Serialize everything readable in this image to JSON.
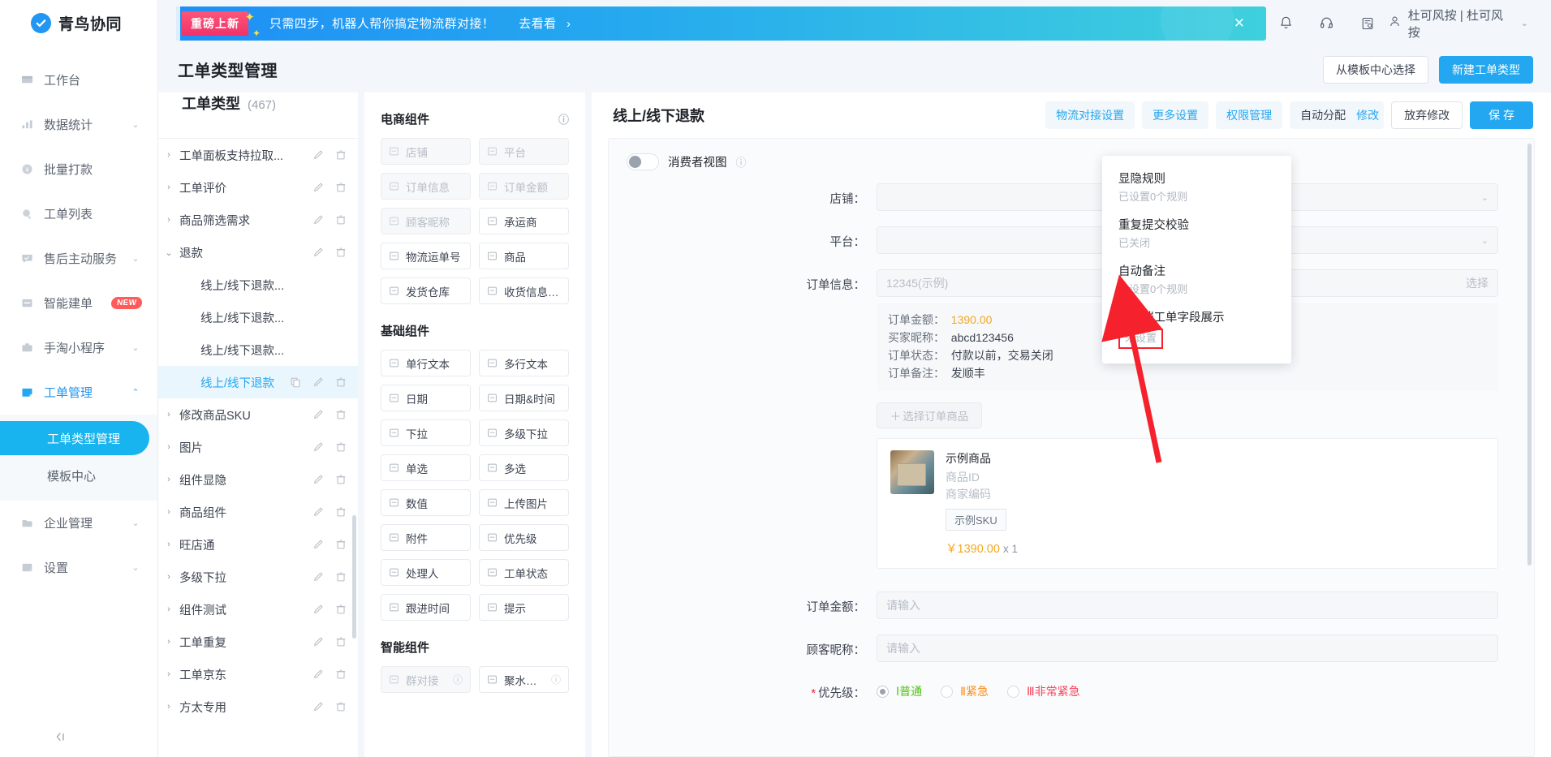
{
  "brand": {
    "name": "青鸟协同",
    "logo_icon": "check-circle-icon"
  },
  "topbar": {
    "promo": {
      "tag": "重磅上新",
      "text": "只需四步，机器人帮你搞定物流群对接！",
      "cta": "去看看",
      "cta_icon": "chevron-right-icon",
      "close_icon": "close-icon",
      "accent_color": "#22a7f0"
    },
    "icons": [
      "bell-icon",
      "headset-icon",
      "document-icon"
    ],
    "user": {
      "avatar_icon": "user-icon",
      "name": "杜可风按 | 杜可风按",
      "caret_icon": "chevron-down-icon"
    }
  },
  "page": {
    "title": "工单类型管理",
    "actions": [
      {
        "label": "从模板中心选择",
        "style": "default"
      },
      {
        "label": "新建工单类型",
        "style": "primary"
      }
    ]
  },
  "tree": {
    "title": "工单类型",
    "count": "(467)",
    "rows": [
      {
        "name": "工单面板支持拉取...",
        "level": 0,
        "expanded": false,
        "selected": false,
        "actions": [
          "edit-icon",
          "delete-icon"
        ]
      },
      {
        "name": "工单评价",
        "level": 0,
        "expanded": false,
        "selected": false,
        "actions": [
          "edit-icon",
          "delete-icon"
        ]
      },
      {
        "name": "商品筛选需求",
        "level": 0,
        "expanded": false,
        "selected": false,
        "actions": [
          "edit-icon",
          "delete-icon"
        ]
      },
      {
        "name": "退款",
        "level": 0,
        "expanded": true,
        "selected": false,
        "actions": [
          "edit-icon",
          "delete-icon"
        ]
      },
      {
        "name": "线上/线下退款...",
        "level": 1,
        "expanded": false,
        "selected": false,
        "actions": []
      },
      {
        "name": "线上/线下退款...",
        "level": 1,
        "expanded": false,
        "selected": false,
        "actions": []
      },
      {
        "name": "线上/线下退款...",
        "level": 1,
        "expanded": false,
        "selected": false,
        "actions": []
      },
      {
        "name": "线上/线下退款",
        "level": 1,
        "expanded": false,
        "selected": true,
        "actions": [
          "copy-icon",
          "edit-icon",
          "delete-icon"
        ]
      },
      {
        "name": "修改商品SKU",
        "level": 0,
        "expanded": false,
        "selected": false,
        "actions": [
          "edit-icon",
          "delete-icon"
        ]
      },
      {
        "name": "图片",
        "level": 0,
        "expanded": false,
        "selected": false,
        "actions": [
          "edit-icon",
          "delete-icon"
        ]
      },
      {
        "name": "组件显隐",
        "level": 0,
        "expanded": false,
        "selected": false,
        "actions": [
          "edit-icon",
          "delete-icon"
        ]
      },
      {
        "name": "商品组件",
        "level": 0,
        "expanded": false,
        "selected": false,
        "actions": [
          "edit-icon",
          "delete-icon"
        ]
      },
      {
        "name": "旺店通",
        "level": 0,
        "expanded": false,
        "selected": false,
        "actions": [
          "edit-icon",
          "delete-icon"
        ]
      },
      {
        "name": "多级下拉",
        "level": 0,
        "expanded": false,
        "selected": false,
        "actions": [
          "edit-icon",
          "delete-icon"
        ]
      },
      {
        "name": "组件测试",
        "level": 0,
        "expanded": false,
        "selected": false,
        "actions": [
          "edit-icon",
          "delete-icon"
        ]
      },
      {
        "name": "工单重复",
        "level": 0,
        "expanded": false,
        "selected": false,
        "actions": [
          "edit-icon",
          "delete-icon"
        ]
      },
      {
        "name": "工单京东",
        "level": 0,
        "expanded": false,
        "selected": false,
        "actions": [
          "edit-icon",
          "delete-icon"
        ]
      },
      {
        "name": "方太专用",
        "level": 0,
        "expanded": false,
        "selected": false,
        "actions": [
          "edit-icon",
          "delete-icon"
        ]
      }
    ]
  },
  "sidebar": {
    "items": [
      {
        "label": "工作台",
        "icon": "workbench-icon",
        "chevron": false,
        "open": false
      },
      {
        "label": "数据统计",
        "icon": "chart-icon",
        "chevron": true,
        "open": false
      },
      {
        "label": "批量打款",
        "icon": "money-icon",
        "chevron": false,
        "open": false
      },
      {
        "label": "工单列表",
        "icon": "search-icon",
        "chevron": false,
        "open": false
      },
      {
        "label": "售后主动服务",
        "icon": "message-icon",
        "chevron": true,
        "open": false
      },
      {
        "label": "智能建单",
        "icon": "form-icon",
        "chevron": false,
        "open": false,
        "badge": "NEW"
      },
      {
        "label": "手淘小程序",
        "icon": "briefcase-icon",
        "chevron": true,
        "open": false
      },
      {
        "label": "工单管理",
        "icon": "ticket-icon",
        "chevron": true,
        "open": true
      }
    ],
    "subitems": [
      {
        "label": "工单类型管理",
        "active": true
      },
      {
        "label": "模板中心",
        "active": false
      }
    ],
    "items_after": [
      {
        "label": "企业管理",
        "icon": "enterprise-icon",
        "chevron": true,
        "open": false
      },
      {
        "label": "设置",
        "icon": "settings-icon",
        "chevron": true,
        "open": false
      }
    ],
    "collapse_icon": "collapse-icon"
  },
  "palette": {
    "sections": [
      {
        "title": "电商组件",
        "has_info": true,
        "items": [
          {
            "label": "店铺",
            "icon": "shop-icon",
            "disabled": true
          },
          {
            "label": "平台",
            "icon": "platform-icon",
            "disabled": true
          },
          {
            "label": "订单信息",
            "icon": "order-icon",
            "disabled": true
          },
          {
            "label": "订单金额",
            "icon": "amount-icon",
            "disabled": true
          },
          {
            "label": "顾客昵称",
            "icon": "customer-icon",
            "disabled": true
          },
          {
            "label": "承运商",
            "icon": "truck-icon",
            "disabled": false
          },
          {
            "label": "物流运单号",
            "icon": "logistics-icon",
            "disabled": false
          },
          {
            "label": "商品",
            "icon": "bag-icon",
            "disabled": false
          },
          {
            "label": "发货仓库",
            "icon": "warehouse-icon",
            "disabled": false
          },
          {
            "label": "收货信息套件",
            "icon": "receipt-icon",
            "disabled": false
          }
        ]
      },
      {
        "title": "基础组件",
        "has_info": false,
        "items": [
          {
            "label": "单行文本",
            "icon": "single-line-icon",
            "disabled": false
          },
          {
            "label": "多行文本",
            "icon": "multi-line-icon",
            "disabled": false
          },
          {
            "label": "日期",
            "icon": "calendar-icon",
            "disabled": false
          },
          {
            "label": "日期&时间",
            "icon": "clock-icon",
            "disabled": false
          },
          {
            "label": "下拉",
            "icon": "dropdown-icon",
            "disabled": false
          },
          {
            "label": "多级下拉",
            "icon": "cascader-icon",
            "disabled": false
          },
          {
            "label": "单选",
            "icon": "radio-icon",
            "disabled": false
          },
          {
            "label": "多选",
            "icon": "checkbox-icon",
            "disabled": false
          },
          {
            "label": "数值",
            "icon": "number-icon",
            "disabled": false
          },
          {
            "label": "上传图片",
            "icon": "image-upload-icon",
            "disabled": false
          },
          {
            "label": "附件",
            "icon": "attachment-icon",
            "disabled": false
          },
          {
            "label": "优先级",
            "icon": "priority-icon",
            "disabled": false
          },
          {
            "label": "处理人",
            "icon": "assignee-icon",
            "disabled": false
          },
          {
            "label": "工单状态",
            "icon": "status-icon",
            "disabled": false
          },
          {
            "label": "跟进时间",
            "icon": "followup-icon",
            "disabled": false
          },
          {
            "label": "提示",
            "icon": "tip-icon",
            "disabled": false
          }
        ]
      },
      {
        "title": "智能组件",
        "has_info": false,
        "items": [
          {
            "label": "群对接",
            "icon": "group-icon",
            "disabled": true,
            "info": true
          },
          {
            "label": "聚水潭...",
            "icon": "jushuitan-icon",
            "disabled": false,
            "info": true
          }
        ]
      }
    ]
  },
  "preview": {
    "title": "线上/线下退款",
    "actions": [
      {
        "label": "物流对接设置",
        "style": "link-chip"
      },
      {
        "label": "更多设置",
        "style": "link-chip"
      },
      {
        "label": "权限管理",
        "style": "link-chip"
      },
      {
        "label": "自动分配",
        "style": "plain-chip",
        "suffix": "修改"
      },
      {
        "label": "放弃修改",
        "style": "outline"
      },
      {
        "label": "保 存",
        "style": "primary"
      }
    ],
    "auto_assign_modify": "修改",
    "consumer_view": {
      "label": "消费者视图",
      "info_icon": "info-icon",
      "enabled": false
    },
    "fields": [
      {
        "label": "店铺：",
        "type": "select",
        "value": "",
        "placeholder": ""
      },
      {
        "label": "平台：",
        "type": "select",
        "value": "",
        "placeholder": ""
      },
      {
        "label": "订单信息：",
        "type": "input-action",
        "placeholder": "12345(示例)",
        "action": "选择"
      }
    ],
    "order_detail": [
      {
        "key": "订单金额：",
        "value": "1390.00",
        "highlight": true
      },
      {
        "key": "买家昵称：",
        "value": "abcd123456",
        "highlight": false
      },
      {
        "key": "订单状态：",
        "value": "付款以前，交易关闭",
        "highlight": false
      },
      {
        "key": "订单备注：",
        "value": "发顺丰",
        "highlight": false
      }
    ],
    "select_goods_button": "选择订单商品",
    "goods": {
      "name": "示例商品",
      "product_id_label": "商品ID",
      "merchant_code_label": "商家编码",
      "sku": "示例SKU",
      "price": "￥1390.00",
      "qty": "x 1"
    },
    "fields_bottom": [
      {
        "label": "订单金额：",
        "placeholder": "请输入"
      },
      {
        "label": "顾客昵称：",
        "placeholder": "请输入"
      }
    ],
    "priority": {
      "label": "优先级：",
      "required": true,
      "options": [
        {
          "prefix": "Ⅰ",
          "label": "普通",
          "selected": true,
          "color": "#52c41a"
        },
        {
          "prefix": "Ⅱ",
          "label": "紧急",
          "selected": false,
          "color": "#fa8c16"
        },
        {
          "prefix": "Ⅲ",
          "label": "非常紧急",
          "selected": false,
          "color": "#f5435b"
        }
      ]
    }
  },
  "dropdown": {
    "items": [
      {
        "title": "显隐规则",
        "sub": "已设置0个规则",
        "highlighted": false
      },
      {
        "title": "重复提交校验",
        "sub": "已关闭",
        "highlighted": false
      },
      {
        "title": "自动备注",
        "sub": "已设置0个规则",
        "highlighted": false
      },
      {
        "title": "客户端工单字段展示",
        "sub": "未设置",
        "highlighted": true
      }
    ]
  },
  "annotation": {
    "arrow_color": "#f5222d",
    "box_color": "#f5222d"
  }
}
